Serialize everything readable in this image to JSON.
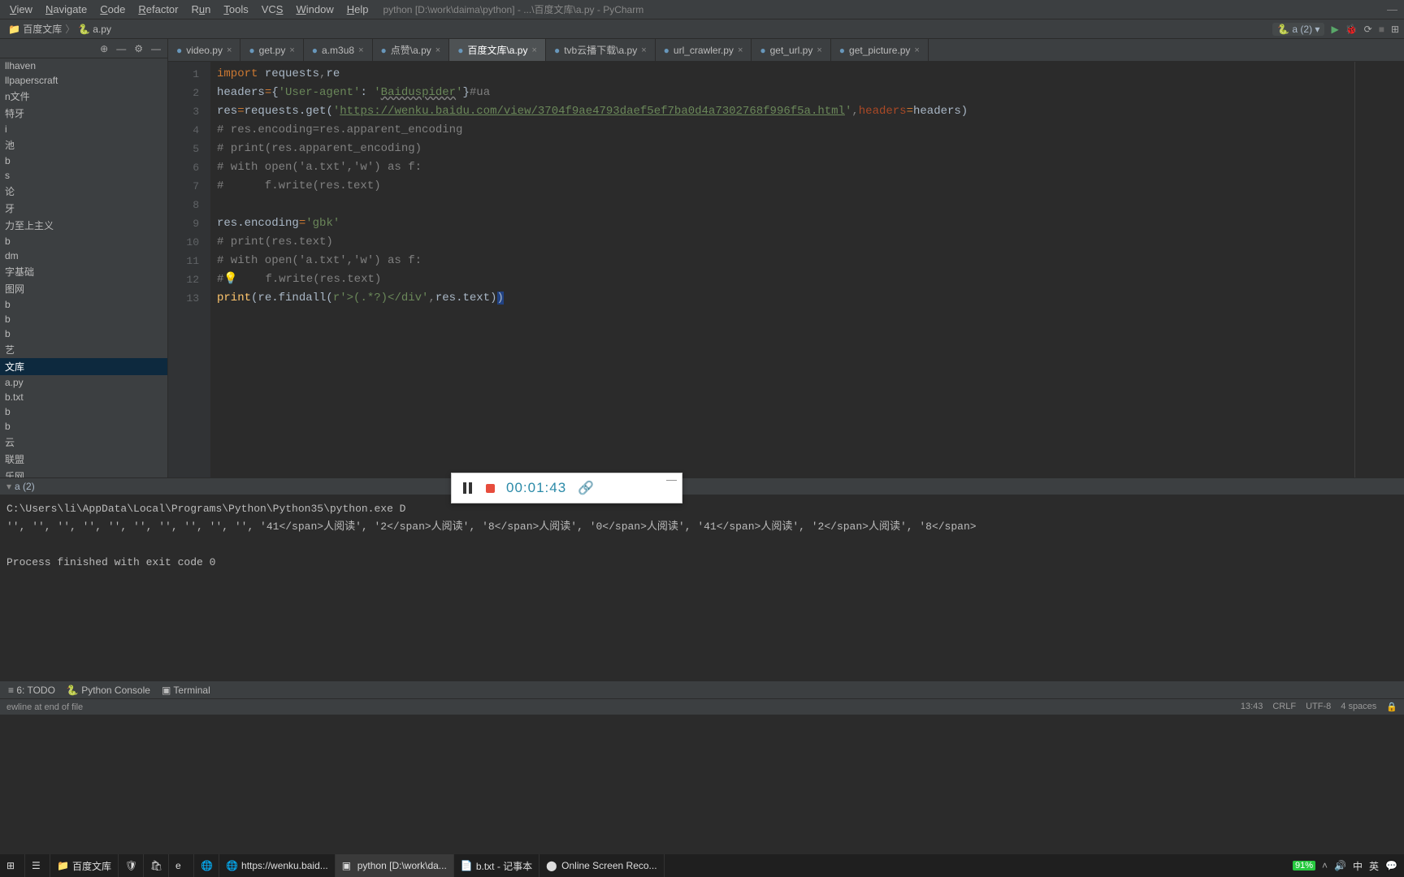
{
  "menu": {
    "items": [
      "View",
      "Navigate",
      "Code",
      "Refactor",
      "Run",
      "Tools",
      "VCS",
      "Window",
      "Help"
    ],
    "title": "python [D:\\work\\daima\\python] - ...\\百度文库\\a.py - PyCharm"
  },
  "breadcrumb": {
    "crumb1": "百度文库",
    "crumb2": "a.py",
    "run_config": "a (2)"
  },
  "sidebar": {
    "items": [
      "llhaven",
      "llpaperscraft",
      "n文件",
      "特牙",
      "i",
      "池",
      "b",
      "s",
      "论",
      "牙",
      "力至上主义",
      "b",
      "dm",
      "字基础",
      "图网",
      "b",
      "b",
      "b",
      "艺",
      "文库",
      "a.py",
      "b.txt",
      "b",
      "b",
      "云",
      "联盟",
      "乐网"
    ],
    "selected_index": 19
  },
  "tabs": [
    {
      "label": "video.py",
      "active": false
    },
    {
      "label": "get.py",
      "active": false
    },
    {
      "label": "a.m3u8",
      "active": false
    },
    {
      "label": "点赞\\a.py",
      "active": false
    },
    {
      "label": "百度文库\\a.py",
      "active": true
    },
    {
      "label": "tvb云播下载\\a.py",
      "active": false
    },
    {
      "label": "url_crawler.py",
      "active": false
    },
    {
      "label": "get_url.py",
      "active": false
    },
    {
      "label": "get_picture.py",
      "active": false
    }
  ],
  "code_lines": [
    "import requests,re",
    "headers={'User-agent': 'Baiduspider'}#ua",
    "res=requests.get('https://wenku.baidu.com/view/3704f9ae4793daef5ef7ba0d4a7302768f996f5a.html',headers=headers)",
    "# res.encoding=res.apparent_encoding",
    "# print(res.apparent_encoding)",
    "# with open('a.txt','w') as f:",
    "#      f.write(res.text)",
    "",
    "res.encoding='gbk'",
    "# print(res.text)",
    "# with open('a.txt','w') as f:",
    "#      f.write(res.text)",
    "print(re.findall(r'>(.*?)</div',res.text))"
  ],
  "run_tab": {
    "label": "a (2)"
  },
  "console": {
    "line1": "C:\\Users\\li\\AppData\\Local\\Programs\\Python\\Python35\\python.exe D",
    "line2": "'', '', '', '', '', '', '', '', '', '', '41</span>人阅读', '2</span>人阅读', '8</span>人阅读', '0</span>人阅读', '41</span>人阅读', '2</span>人阅读', '8</span>",
    "line3": "",
    "line4": "Process finished with exit code 0"
  },
  "bottom_tools": {
    "todo": "6: TODO",
    "pyconsole": "Python Console",
    "terminal": "Terminal"
  },
  "statusbar": {
    "left": "ewline at end of file",
    "pos": "13:43",
    "crlf": "CRLF",
    "enc": "UTF-8",
    "spaces": "4 spaces",
    "lock": "🔒"
  },
  "recorder": {
    "time": "00:01:43"
  },
  "taskbar": {
    "items": [
      {
        "label": "",
        "icon": "win"
      },
      {
        "label": "",
        "icon": "task"
      },
      {
        "label": "百度文库",
        "icon": "folder"
      },
      {
        "label": "",
        "icon": "sec"
      },
      {
        "label": "",
        "icon": "store"
      },
      {
        "label": "",
        "icon": "edge"
      },
      {
        "label": "",
        "icon": "browser"
      },
      {
        "label": "https://wenku.baid...",
        "icon": "browser"
      },
      {
        "label": "python [D:\\work\\da...",
        "icon": "pycharm"
      },
      {
        "label": "b.txt - 记事本",
        "icon": "notepad"
      },
      {
        "label": "Online Screen Reco...",
        "icon": "app"
      }
    ],
    "battery": "91%",
    "ime1": "中",
    "ime2": "英",
    "notif": "💬"
  }
}
